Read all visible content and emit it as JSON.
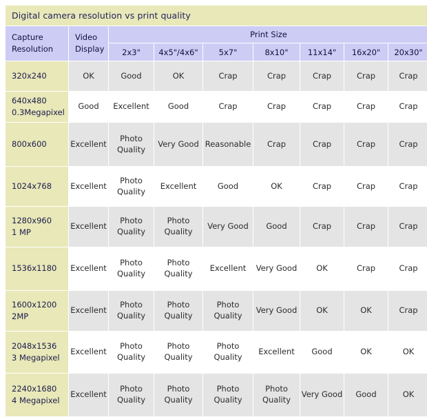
{
  "title": "Digital camera resolution vs print quality",
  "colors": {
    "title_bg": "#e8e8b9",
    "header_bg": "#ccccf5",
    "row_header_bg": "#e8e8b9",
    "shaded_cell_bg": "#e4e4e4",
    "plain_cell_bg": "#ffffff",
    "text": "#2b2b2b",
    "heading_text": "#101040"
  },
  "header": {
    "capture_resolution": "Capture\nResolution",
    "capture_resolution_line1": "Capture",
    "capture_resolution_line2": "Resolution",
    "video_display_line1": "Video",
    "video_display_line2": "Display",
    "print_size_group": "Print Size",
    "print_sizes": [
      "2x3\"",
      "4x5\"/4x6\"",
      "5x7\"",
      "8x10\"",
      "11x14\"",
      "16x20\"",
      "20x30\""
    ]
  },
  "chart_data": {
    "type": "table",
    "title": "Digital camera resolution vs print quality",
    "row_header_labels": [
      "Capture Resolution",
      "Video Display"
    ],
    "column_group": "Print Size",
    "columns": [
      "Capture Resolution",
      "Video Display",
      "2x3\"",
      "4x5\"/4x6\"",
      "5x7\"",
      "8x10\"",
      "11x14\"",
      "16x20\"",
      "20x30\""
    ],
    "rows": [
      {
        "resolution_line1": "320x240",
        "resolution_line2": "",
        "video_display": "OK",
        "values": [
          "Good",
          "OK",
          "Crap",
          "Crap",
          "Crap",
          "Crap",
          "Crap"
        ],
        "shaded": true
      },
      {
        "resolution_line1": "640x480",
        "resolution_line2": "0.3Megapixel",
        "video_display": "Good",
        "values": [
          "Excellent",
          "Good",
          "Crap",
          "Crap",
          "Crap",
          "Crap",
          "Crap"
        ],
        "shaded": false
      },
      {
        "resolution_line1": "800x600",
        "resolution_line2": "",
        "video_display": "Excellent",
        "values": [
          "Photo Quality",
          "Very Good",
          "Reasonable",
          "Crap",
          "Crap",
          "Crap",
          "Crap"
        ],
        "shaded": true
      },
      {
        "resolution_line1": "1024x768",
        "resolution_line2": "",
        "video_display": "Excellent",
        "values": [
          "Photo Quality",
          "Excellent",
          "Good",
          "OK",
          "Crap",
          "Crap",
          "Crap"
        ],
        "shaded": false
      },
      {
        "resolution_line1": "1280x960",
        "resolution_line2": "1 MP",
        "video_display": "Excellent",
        "values": [
          "Photo Quality",
          "Photo Quality",
          "Very Good",
          "Good",
          "Crap",
          "Crap",
          "Crap"
        ],
        "shaded": true
      },
      {
        "resolution_line1": "1536x1180",
        "resolution_line2": "",
        "video_display": "Excellent",
        "values": [
          "Photo Quality",
          "Photo Quality",
          "Excellent",
          "Very Good",
          "OK",
          "Crap",
          "Crap"
        ],
        "shaded": false
      },
      {
        "resolution_line1": "1600x1200",
        "resolution_line2": "2MP",
        "video_display": "Excellent",
        "values": [
          "Photo Quality",
          "Photo Quality",
          "Photo Quality",
          "Very Good",
          "OK",
          "OK",
          "Crap"
        ],
        "shaded": true
      },
      {
        "resolution_line1": "2048x1536",
        "resolution_line2": "3 Megapixel",
        "video_display": "Excellent",
        "values": [
          "Photo Quality",
          "Photo Quality",
          "Photo Quality",
          "Excellent",
          "Good",
          "OK",
          "OK"
        ],
        "shaded": false
      },
      {
        "resolution_line1": "2240x1680",
        "resolution_line2": "4 Megapixel",
        "video_display": "Excellent",
        "values": [
          "Photo Quality",
          "Photo Quality",
          "Photo Quality",
          "Photo Quality",
          "Very Good",
          "Good",
          "OK"
        ],
        "shaded": true
      }
    ]
  }
}
